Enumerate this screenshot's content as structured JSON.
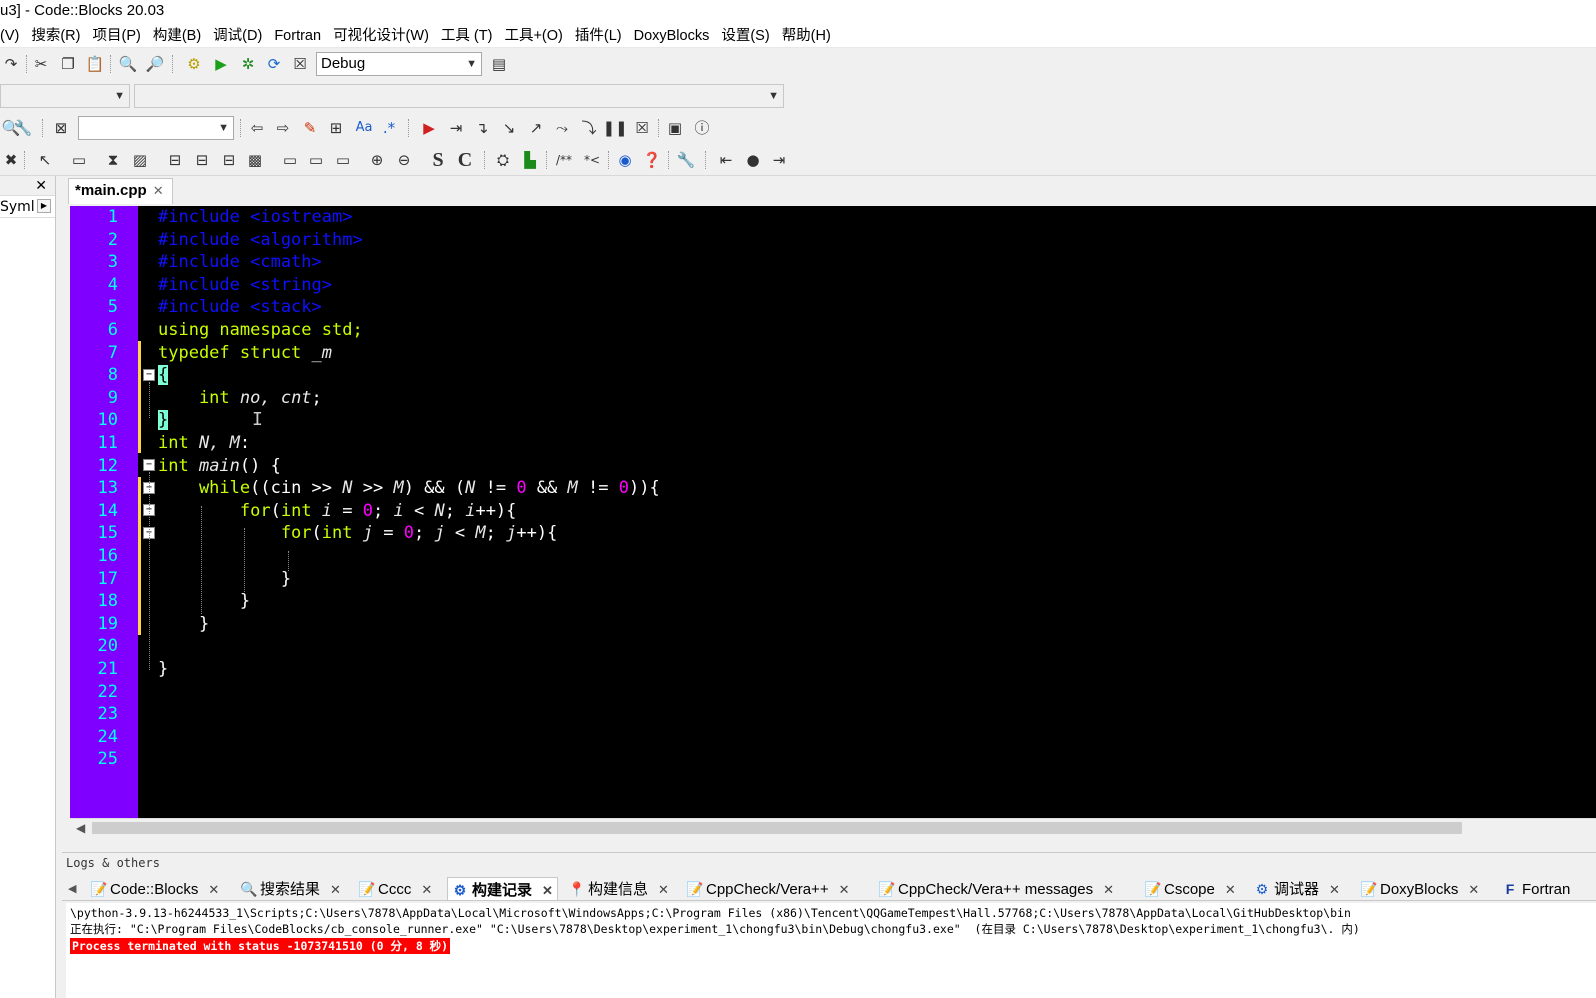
{
  "window": {
    "title": "u3] - Code::Blocks 20.03"
  },
  "menu": [
    "(V)",
    "搜索(R)",
    "项目(P)",
    "构建(B)",
    "调试(D)",
    "Fortran",
    "可视化设计(W)",
    "工具 (T)",
    "工具+(O)",
    "插件(L)",
    "DoxyBlocks",
    "设置(S)",
    "帮助(H)"
  ],
  "toolbar": {
    "build_target": "Debug"
  },
  "left_panel": {
    "tab_label": "Syml"
  },
  "editor": {
    "tab_label": "*main.cpp",
    "line_numbers": [
      "1",
      "2",
      "3",
      "4",
      "5",
      "6",
      "7",
      "8",
      "9",
      "10",
      "11",
      "12",
      "13",
      "14",
      "15",
      "16",
      "17",
      "18",
      "19",
      "20",
      "21",
      "22",
      "23",
      "24",
      "25"
    ]
  },
  "code": {
    "l1": "#include <iostream>",
    "l2": "#include <algorithm>",
    "l3": "#include <cmath>",
    "l4": "#include <string>",
    "l5": "#include <stack>",
    "l6": "using namespace std;",
    "l7a": "typedef struct ",
    "l7b": "_m",
    "l8": "{",
    "l9a": "    int ",
    "l9b": "no, cnt",
    "l9c": ";",
    "l10": "}",
    "l11a": "int ",
    "l11b": "N, M",
    "l11c": ":",
    "l12a": "int ",
    "l12b": "main",
    "l12c": "() {",
    "l13a": "    while",
    "l13b": "((cin >> ",
    "l13c": "N",
    "l13d": " >> ",
    "l13e": "M",
    "l13f": ") && (",
    "l13g": "N",
    "l13h": " != ",
    "l13i": "0",
    "l13j": " && ",
    "l13k": "M",
    "l13l": " != ",
    "l13m": "0",
    "l13n": ")){",
    "l14a": "        for",
    "l14b": "(",
    "l14c": "int ",
    "l14d": "i",
    "l14e": " = ",
    "l14f": "0",
    "l14g": "; ",
    "l14h": "i",
    "l14i": " < ",
    "l14j": "N",
    "l14k": "; ",
    "l14l": "i",
    "l14m": "++){",
    "l15a": "            for",
    "l15b": "(",
    "l15c": "int ",
    "l15d": "j",
    "l15e": " = ",
    "l15f": "0",
    "l15g": "; ",
    "l15h": "j",
    "l15i": " < ",
    "l15j": "M",
    "l15k": "; ",
    "l15l": "j",
    "l15m": "++){",
    "l17": "            }",
    "l18": "        }",
    "l19": "    }",
    "l21": "}"
  },
  "logs": {
    "title": "Logs & others",
    "tabs": [
      "Code::Blocks",
      "搜索结果",
      "Cccc",
      "构建记录",
      "构建信息",
      "CppCheck/Vera++",
      "CppCheck/Vera++ messages",
      "Cscope",
      "调试器",
      "DoxyBlocks",
      "Fortran"
    ],
    "lines": [
      "\\python-3.9.13-h6244533_1\\Scripts;C:\\Users\\7878\\AppData\\Local\\Microsoft\\WindowsApps;C:\\Program Files (x86)\\Tencent\\QQGameTempest\\Hall.57768;C:\\Users\\7878\\AppData\\Local\\GitHubDesktop\\bin",
      "正在执行: \"C:\\Program Files\\CodeBlocks/cb_console_runner.exe\" \"C:\\Users\\7878\\Desktop\\experiment_1\\chongfu3\\bin\\Debug\\chongfu3.exe\"  (在目录 C:\\Users\\7878\\Desktop\\experiment_1\\chongfu3\\. 内)",
      "Process terminated with status -1073741510 (0 分, 8 秒)"
    ]
  },
  "colors": {
    "gutter": "#8000ff",
    "line_number": "#00ffff",
    "keyword": "#c8ff00",
    "preprocessor": "#1010ff",
    "number": "#ff00ff",
    "error_bg": "#ff0000"
  }
}
